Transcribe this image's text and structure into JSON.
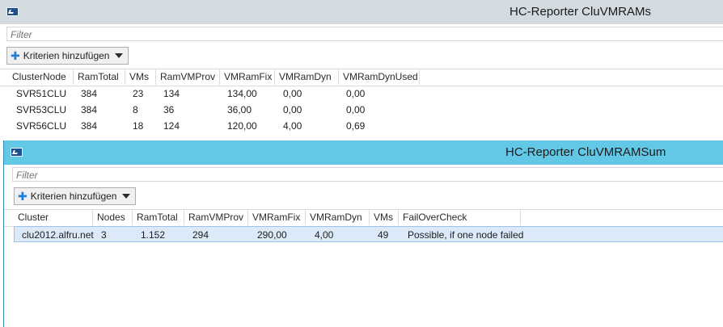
{
  "window1": {
    "title": "HC-Reporter CluVMRAMs",
    "filter_placeholder": "Filter",
    "criteria_button": "Kriterien hinzufügen",
    "columns": [
      "ClusterNode",
      "RamTotal",
      "VMs",
      "RamVMProv",
      "VMRamFix",
      "VMRamDyn",
      "VMRamDynUsed"
    ],
    "rows": [
      [
        "SVR51CLU",
        "384",
        "23",
        "134",
        "134,00",
        "0,00",
        "0,00"
      ],
      [
        "SVR53CLU",
        "384",
        "8",
        "36",
        "36,00",
        "0,00",
        "0,00"
      ],
      [
        "SVR56CLU",
        "384",
        "18",
        "124",
        "120,00",
        "4,00",
        "0,69"
      ]
    ]
  },
  "window2": {
    "title": "HC-Reporter CluVMRAMSum",
    "filter_placeholder": "Filter",
    "criteria_button": "Kriterien hinzufügen",
    "columns": [
      "Cluster",
      "Nodes",
      "RamTotal",
      "RamVMProv",
      "VMRamFix",
      "VMRamDyn",
      "VMs",
      "FailOverCheck"
    ],
    "rows": [
      [
        "clu2012.alfru.net",
        "3",
        "1.152",
        "294",
        "290,00",
        "4,00",
        "49",
        "Possible, if one node failed"
      ]
    ]
  },
  "colors": {
    "titlebar_inactive": "#d3dbe0",
    "titlebar_active": "#62c8e6",
    "selection": "#dbe9f8"
  },
  "icons": [
    "powershell-app-icon",
    "plus-icon",
    "dropdown-caret-icon"
  ]
}
